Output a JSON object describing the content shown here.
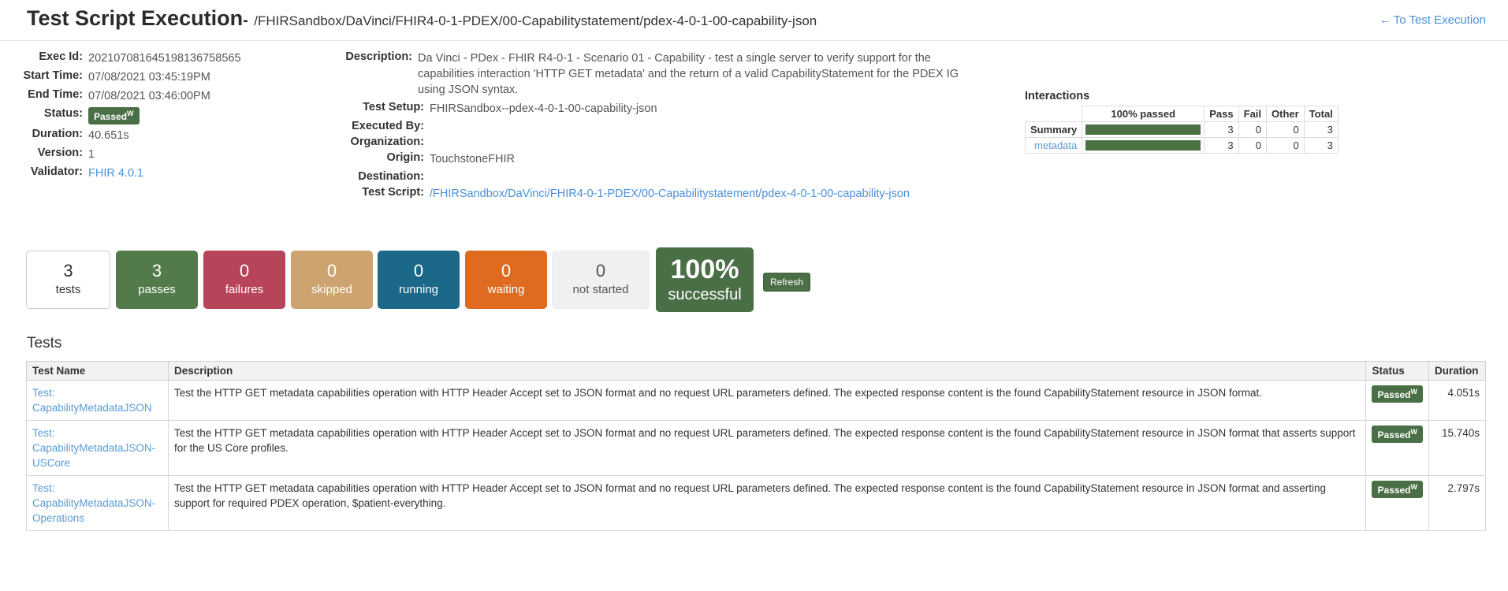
{
  "header": {
    "title": "Test Script Execution",
    "separator": "-",
    "subtitle": "/FHIRSandbox/DaVinci/FHIR4-0-1-PDEX/00-Capabilitystatement/pdex-4-0-1-00-capability-json",
    "back_link": "To Test Execution",
    "back_arrow": "←"
  },
  "details_left": {
    "rows": [
      {
        "label": "Exec Id:",
        "value": "202107081645198136758565"
      },
      {
        "label": "Start Time:",
        "value": "07/08/2021 03:45:19PM"
      },
      {
        "label": "End Time:",
        "value": "07/08/2021 03:46:00PM"
      },
      {
        "label": "Status:",
        "value": "Passed"
      },
      {
        "label": "Duration:",
        "value": "40.651s"
      },
      {
        "label": "Version:",
        "value": "1"
      },
      {
        "label": "Validator:",
        "value": "FHIR 4.0.1"
      }
    ],
    "status_badge": "Passed",
    "status_badge_sup": "W"
  },
  "details_mid": {
    "description_label": "Description:",
    "description": "Da Vinci - PDex - FHIR R4-0-1 - Scenario 01 - Capability - test a single server to verify support for the capabilities interaction 'HTTP GET metadata' and the return of a valid CapabilityStatement for the PDEX IG using JSON syntax.",
    "test_setup_label": "Test Setup:",
    "test_setup": "FHIRSandbox--pdex-4-0-1-00-capability-json",
    "executed_by_label": "Executed By:",
    "executed_by": "",
    "organization_label": "Organization:",
    "organization": "",
    "origin_label": "Origin:",
    "origin": "TouchstoneFHIR",
    "destination_label": "Destination:",
    "destination": "",
    "test_script_label": "Test Script:",
    "test_script": "/FHIRSandbox/DaVinci/FHIR4-0-1-PDEX/00-Capabilitystatement/pdex-4-0-1-00-capability-json"
  },
  "interactions": {
    "title": "Interactions",
    "columns": [
      "",
      "100% passed",
      "Pass",
      "Fail",
      "Other",
      "Total"
    ],
    "rows": [
      {
        "name": "Summary",
        "is_link": false,
        "percent": 100,
        "pass": "3",
        "fail": "0",
        "other": "0",
        "total": "3"
      },
      {
        "name": "metadata",
        "is_link": true,
        "percent": 100,
        "pass": "3",
        "fail": "0",
        "other": "0",
        "total": "3"
      }
    ],
    "bar_color": "#4a7243"
  },
  "stats": [
    {
      "num": "3",
      "label": "tests",
      "style": "outline",
      "color": "#ffffff"
    },
    {
      "num": "3",
      "label": "passes",
      "style": "fill",
      "color": "#537a4a"
    },
    {
      "num": "0",
      "label": "failures",
      "style": "fill",
      "color": "#b8445a"
    },
    {
      "num": "0",
      "label": "skipped",
      "style": "fill",
      "color": "#cda470"
    },
    {
      "num": "0",
      "label": "running",
      "style": "fill",
      "color": "#1b6888"
    },
    {
      "num": "0",
      "label": "waiting",
      "style": "fill",
      "color": "#de6b20"
    },
    {
      "num": "0",
      "label": "not started",
      "style": "muted",
      "color": "#f0f0f0"
    },
    {
      "num": "100%",
      "label": "successful",
      "style": "big",
      "color": "#4a6e45"
    }
  ],
  "refresh_label": "Refresh",
  "tests": {
    "heading": "Tests",
    "columns": [
      "Test Name",
      "Description",
      "Status",
      "Duration"
    ],
    "rows": [
      {
        "prefix": "Test:",
        "name": "CapabilityMetadataJSON",
        "description": "Test the HTTP GET metadata capabilities operation with HTTP Header Accept set to JSON format and no request URL parameters defined. The expected response content is the found CapabilityStatement resource in JSON format.",
        "status": "Passed",
        "status_sup": "W",
        "duration": "4.051s"
      },
      {
        "prefix": "Test:",
        "name": "CapabilityMetadataJSON-USCore",
        "description": "Test the HTTP GET metadata capabilities operation with HTTP Header Accept set to JSON format and no request URL parameters defined. The expected response content is the found CapabilityStatement resource in JSON format that asserts support for the US Core profiles.",
        "status": "Passed",
        "status_sup": "W",
        "duration": "15.740s"
      },
      {
        "prefix": "Test:",
        "name": "CapabilityMetadataJSON-Operations",
        "description": "Test the HTTP GET metadata capabilities operation with HTTP Header Accept set to JSON format and no request URL parameters defined. The expected response content is the found CapabilityStatement resource in JSON format and asserting support for required PDEX operation, $patient-everything.",
        "status": "Passed",
        "status_sup": "W",
        "duration": "2.797s"
      }
    ]
  }
}
